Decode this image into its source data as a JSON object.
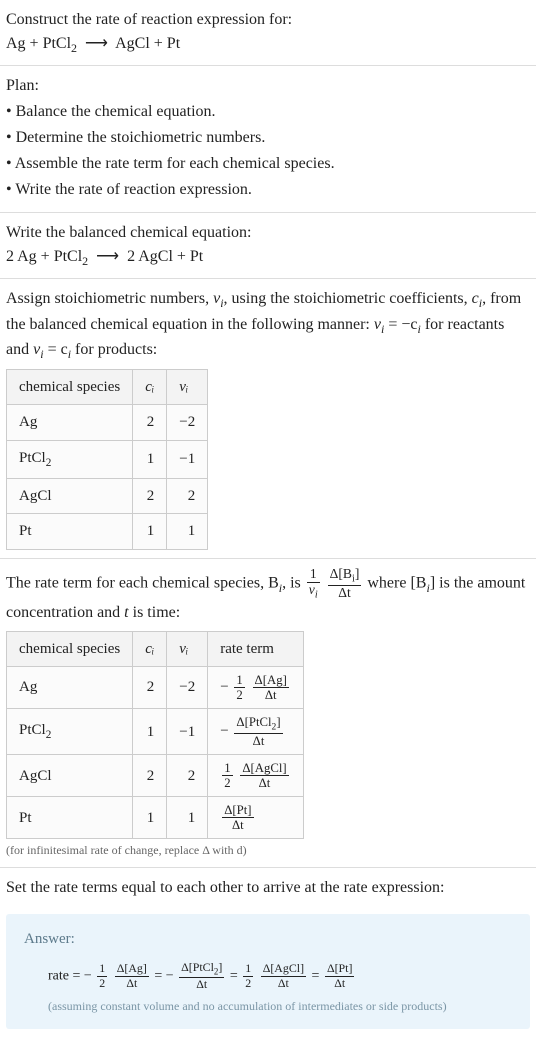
{
  "intro": {
    "prompt": "Construct the rate of reaction expression for:",
    "equation_lhs": "Ag + PtCl",
    "equation_sub": "2",
    "equation_arrow": "⟶",
    "equation_rhs": "AgCl + Pt"
  },
  "plan": {
    "heading": "Plan:",
    "items": [
      "Balance the chemical equation.",
      "Determine the stoichiometric numbers.",
      "Assemble the rate term for each chemical species.",
      "Write the rate of reaction expression."
    ]
  },
  "balanced": {
    "lead": "Write the balanced chemical equation:",
    "lhs": "2 Ag + PtCl",
    "sub": "2",
    "arrow": "⟶",
    "rhs": "2 AgCl + Pt"
  },
  "stoich": {
    "lead_a": "Assign stoichiometric numbers, ",
    "nu_i": "ν",
    "nu_sub": "i",
    "lead_b": ", using the stoichiometric coefficients, ",
    "c_i": "c",
    "c_sub": "i",
    "lead_c": ", from the balanced chemical equation in the following manner: ",
    "rel1": "ν",
    "rel1_sub": "i",
    "rel1_eq": " = −c",
    "rel1_sub2": "i",
    "rel1_tail": " for reactants and ",
    "rel2": "ν",
    "rel2_sub": "i",
    "rel2_eq": " = c",
    "rel2_sub2": "i",
    "rel2_tail": " for products:",
    "table": {
      "headers": [
        "chemical species",
        "cᵢ",
        "νᵢ"
      ],
      "rows": [
        {
          "species": "Ag",
          "c": "2",
          "nu": "−2"
        },
        {
          "species_a": "PtCl",
          "species_sub": "2",
          "c": "1",
          "nu": "−1"
        },
        {
          "species": "AgCl",
          "c": "2",
          "nu": "2"
        },
        {
          "species": "Pt",
          "c": "1",
          "nu": "1"
        }
      ]
    }
  },
  "rateterm": {
    "lead_a": "The rate term for each chemical species, B",
    "lead_a_sub": "i",
    "lead_b": ", is ",
    "frac1_top": "1",
    "frac1_bot_a": "ν",
    "frac1_bot_sub": "i",
    "frac2_top_a": "Δ[B",
    "frac2_top_sub": "i",
    "frac2_top_b": "]",
    "frac2_bot": "Δt",
    "lead_c": " where [B",
    "lead_c_sub": "i",
    "lead_d": "] is the amount concentration and ",
    "t": "t",
    "lead_e": " is time:",
    "table": {
      "headers": [
        "chemical species",
        "cᵢ",
        "νᵢ",
        "rate term"
      ],
      "rows": [
        {
          "species": "Ag",
          "c": "2",
          "nu": "−2",
          "rt_sign": "−",
          "rt_f1_top": "1",
          "rt_f1_bot": "2",
          "rt_f2_top": "Δ[Ag]",
          "rt_f2_bot": "Δt"
        },
        {
          "species_a": "PtCl",
          "species_sub": "2",
          "c": "1",
          "nu": "−1",
          "rt_sign": "−",
          "rt_f2_top_a": "Δ[PtCl",
          "rt_f2_top_sub": "2",
          "rt_f2_top_b": "]",
          "rt_f2_bot": "Δt"
        },
        {
          "species": "AgCl",
          "c": "2",
          "nu": "2",
          "rt_f1_top": "1",
          "rt_f1_bot": "2",
          "rt_f2_top": "Δ[AgCl]",
          "rt_f2_bot": "Δt"
        },
        {
          "species": "Pt",
          "c": "1",
          "nu": "1",
          "rt_f2_top": "Δ[Pt]",
          "rt_f2_bot": "Δt"
        }
      ]
    },
    "note": "(for infinitesimal rate of change, replace Δ with d)"
  },
  "final": {
    "lead": "Set the rate terms equal to each other to arrive at the rate expression:"
  },
  "answer": {
    "label": "Answer:",
    "rate_word": "rate = ",
    "neg": "−",
    "half_top": "1",
    "half_bot": "2",
    "dAg_top": "Δ[Ag]",
    "dAg_bot": "Δt",
    "eq": " = ",
    "dPtCl_top_a": "Δ[PtCl",
    "dPtCl_top_sub": "2",
    "dPtCl_top_b": "]",
    "dPtCl_bot": "Δt",
    "dAgCl_top": "Δ[AgCl]",
    "dAgCl_bot": "Δt",
    "dPt_top": "Δ[Pt]",
    "dPt_bot": "Δt",
    "assumption": "(assuming constant volume and no accumulation of intermediates or side products)"
  }
}
